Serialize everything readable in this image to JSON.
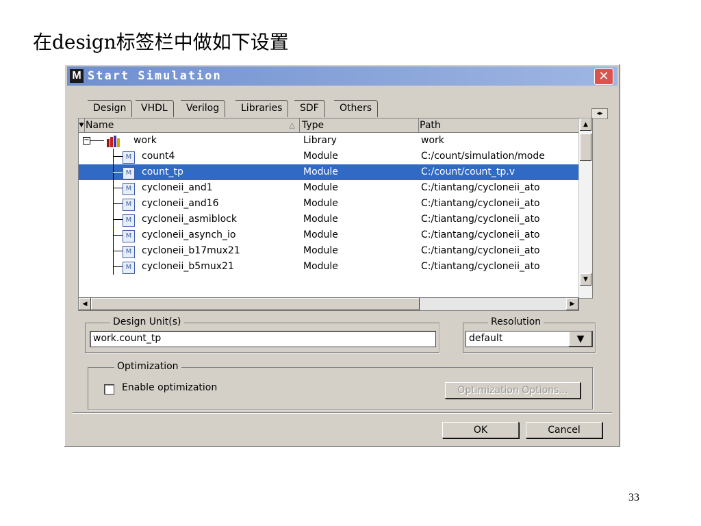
{
  "slide": {
    "title": "在design标签栏中做如下设置",
    "page_number": "33"
  },
  "dialog": {
    "title": "Start Simulation",
    "logo_letter": "M",
    "tabs": [
      "Design",
      "VHDL",
      "Verilog",
      "Libraries",
      "SDF",
      "Others"
    ],
    "columns": [
      "Name",
      "Type",
      "Path"
    ],
    "library": {
      "name": "work",
      "type": "Library",
      "path": "work"
    },
    "modules": [
      {
        "name": "count4",
        "type": "Module",
        "path": "C:/count/simulation/mode"
      },
      {
        "name": "count_tp",
        "type": "Module",
        "path": "C:/count/count_tp.v",
        "selected": true
      },
      {
        "name": "cycloneii_and1",
        "type": "Module",
        "path": "C:/tiantang/cycloneii_ato"
      },
      {
        "name": "cycloneii_and16",
        "type": "Module",
        "path": "C:/tiantang/cycloneii_ato"
      },
      {
        "name": "cycloneii_asmiblock",
        "type": "Module",
        "path": "C:/tiantang/cycloneii_ato"
      },
      {
        "name": "cycloneii_asynch_io",
        "type": "Module",
        "path": "C:/tiantang/cycloneii_ato"
      },
      {
        "name": "cycloneii_b17mux21",
        "type": "Module",
        "path": "C:/tiantang/cycloneii_ato"
      },
      {
        "name": "cycloneii_b5mux21",
        "type": "Module",
        "path": "C:/tiantang/cycloneii_ato"
      }
    ],
    "design_unit": {
      "label": "Design Unit(s)",
      "value": "work.count_tp"
    },
    "resolution": {
      "label": "Resolution",
      "value": "default"
    },
    "optimization": {
      "label": "Optimization",
      "checkbox_label": "Enable optimization",
      "checked": false,
      "options_button": "Optimization Options..."
    },
    "ok_label": "OK",
    "cancel_label": "Cancel",
    "colors": {
      "selection": "#316ac5",
      "face": "#d4d0c8",
      "close": "#d9534f"
    }
  }
}
